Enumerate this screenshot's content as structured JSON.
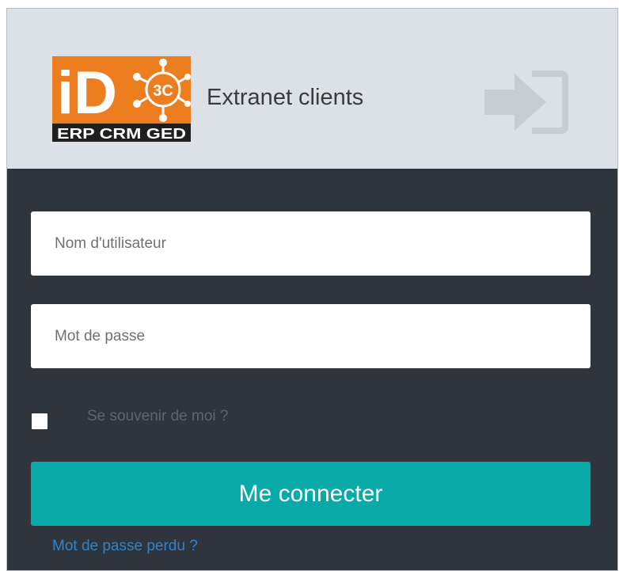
{
  "header": {
    "logo": {
      "mark": "iD",
      "badge": "3C",
      "tagline": "ERP CRM GED"
    },
    "title": "Extranet clients",
    "login_icon": "sign-in-icon"
  },
  "form": {
    "username_placeholder": "Nom d'utilisateur",
    "password_placeholder": "Mot de passe",
    "remember_label": "Se souvenir de moi ?",
    "remember_checked": false,
    "submit_label": "Me connecter",
    "lost_password_label": "Mot de passe perdu ?"
  },
  "colors": {
    "header_bg": "#dce1e8",
    "body_bg": "#2e353d",
    "accent": "#08a9a9",
    "link": "#2f83cc",
    "logo_orange": "#ec7e1f"
  }
}
